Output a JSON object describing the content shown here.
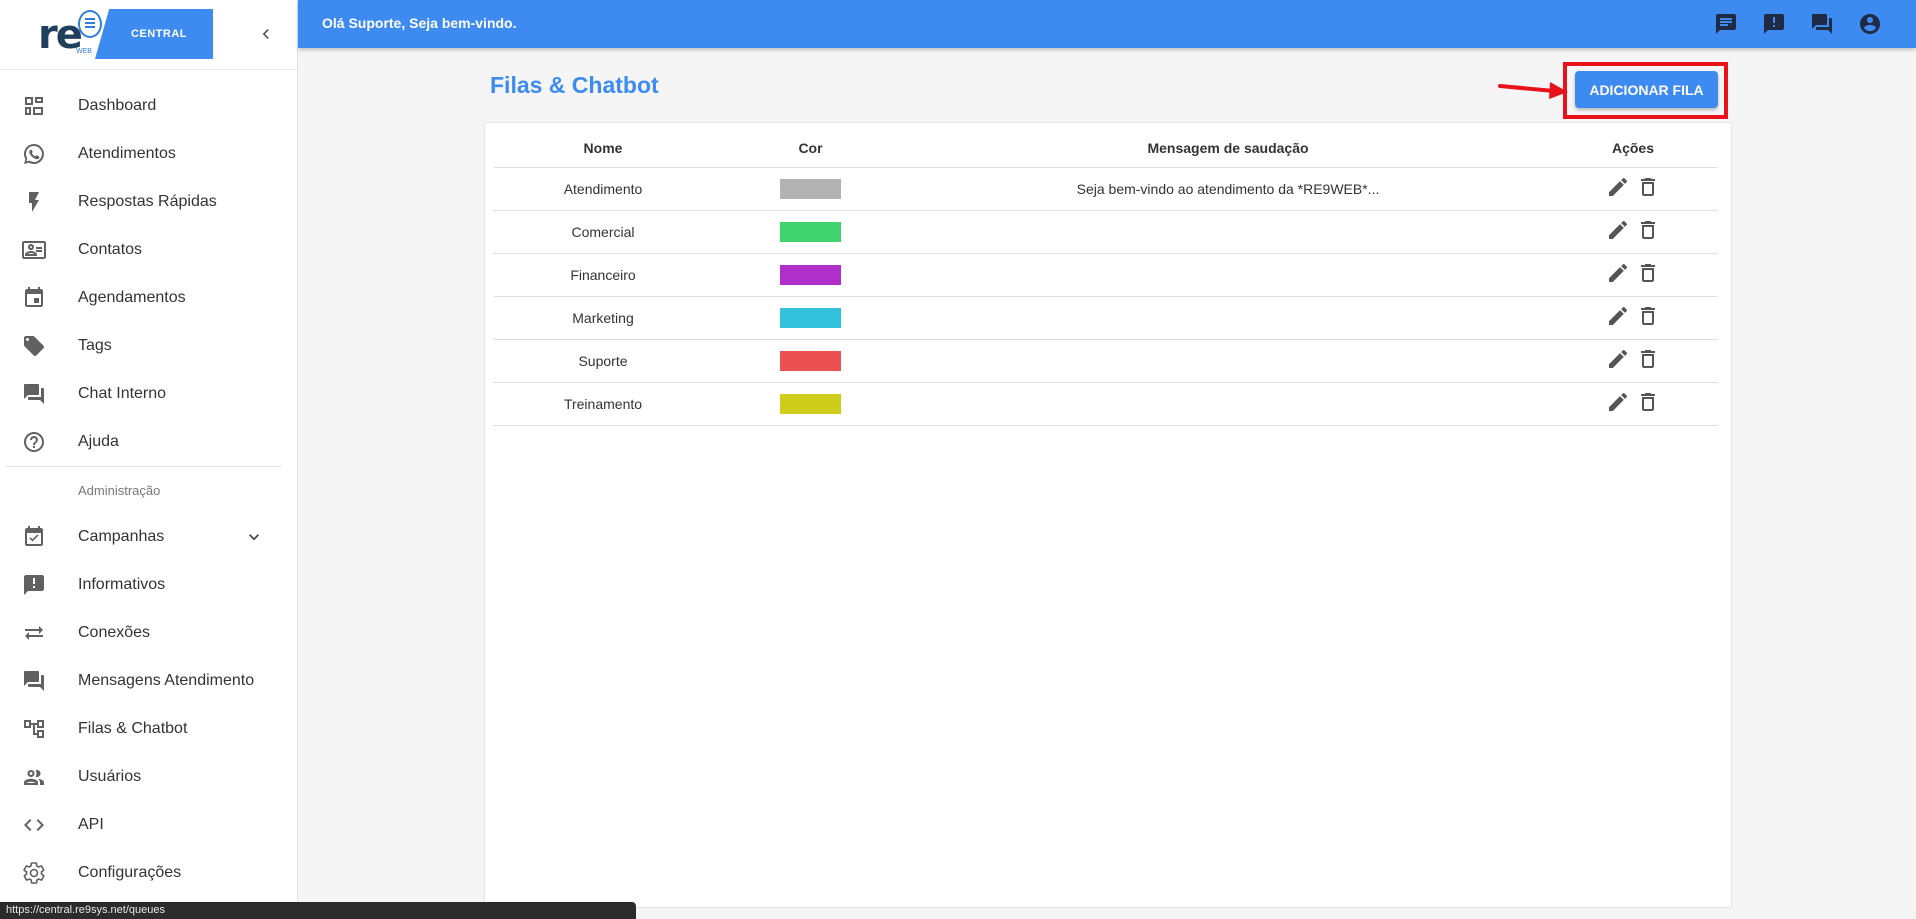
{
  "logo": {
    "brand": "re",
    "badge": "CENTRAL",
    "sub": "WEB"
  },
  "sidebar": {
    "items": [
      {
        "label": "Dashboard",
        "icon": "dashboard-icon"
      },
      {
        "label": "Atendimentos",
        "icon": "whatsapp-icon"
      },
      {
        "label": "Respostas Rápidas",
        "icon": "flash-icon"
      },
      {
        "label": "Contatos",
        "icon": "contact-card-icon"
      },
      {
        "label": "Agendamentos",
        "icon": "calendar-icon"
      },
      {
        "label": "Tags",
        "icon": "tag-icon"
      },
      {
        "label": "Chat Interno",
        "icon": "forum-icon"
      },
      {
        "label": "Ajuda",
        "icon": "help-icon"
      }
    ],
    "admin_header": "Administração",
    "admin_items": [
      {
        "label": "Campanhas",
        "icon": "event-check-icon"
      },
      {
        "label": "Informativos",
        "icon": "announcement-icon"
      },
      {
        "label": "Conexões",
        "icon": "sync-arrows-icon"
      },
      {
        "label": "Mensagens Atendimento",
        "icon": "forum-icon"
      },
      {
        "label": "Filas & Chatbot",
        "icon": "hierarchy-icon"
      },
      {
        "label": "Usuários",
        "icon": "people-icon"
      },
      {
        "label": "API",
        "icon": "code-icon"
      },
      {
        "label": "Configurações",
        "icon": "gear-icon"
      }
    ]
  },
  "topbar": {
    "greeting": "Olá Suporte, Seja bem-vindo."
  },
  "page": {
    "title": "Filas & Chatbot",
    "add_button": "ADICIONAR FILA"
  },
  "table": {
    "headers": {
      "name": "Nome",
      "color": "Cor",
      "message": "Mensagem de saudação",
      "actions": "Ações"
    },
    "rows": [
      {
        "name": "Atendimento",
        "color": "#b3b3b3",
        "message": "Seja bem-vindo ao atendimento da *RE9WEB*..."
      },
      {
        "name": "Comercial",
        "color": "#3fd46e",
        "message": ""
      },
      {
        "name": "Financeiro",
        "color": "#b02fcb",
        "message": ""
      },
      {
        "name": "Marketing",
        "color": "#33c1dc",
        "message": ""
      },
      {
        "name": "Suporte",
        "color": "#ec5152",
        "message": ""
      },
      {
        "name": "Treinamento",
        "color": "#cfcc1b",
        "message": ""
      }
    ]
  },
  "statusbar": {
    "url": "https://central.re9sys.net/queues"
  },
  "colors": {
    "accent": "#3d8bf0",
    "highlight": "#e8121b"
  }
}
